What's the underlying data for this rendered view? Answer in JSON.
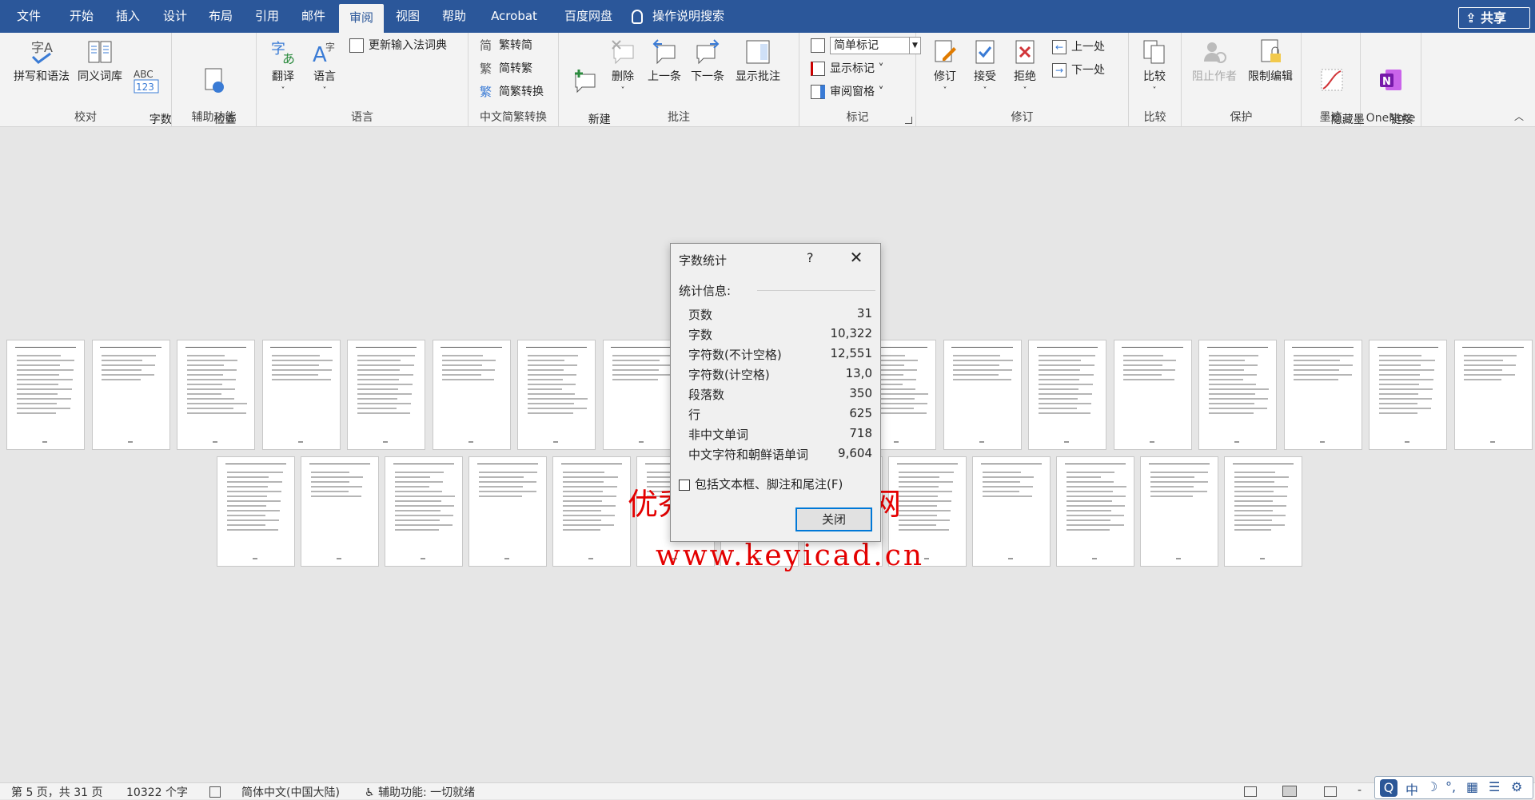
{
  "menubar": {
    "tabs": [
      {
        "label": "文件"
      },
      {
        "label": "开始"
      },
      {
        "label": "插入"
      },
      {
        "label": "设计"
      },
      {
        "label": "布局"
      },
      {
        "label": "引用"
      },
      {
        "label": "邮件"
      },
      {
        "label": "审阅"
      },
      {
        "label": "视图"
      },
      {
        "label": "帮助"
      },
      {
        "label": "Acrobat"
      },
      {
        "label": "百度网盘"
      }
    ],
    "active_tab": "审阅",
    "tell_me": "操作说明搜索",
    "share": "共享",
    "bg_color": "#2b579a"
  },
  "ribbon": {
    "proofing": {
      "label": "校对",
      "spell": "拼写和语法",
      "thesaurus": "同义词库",
      "wordcount": "字数\n统计"
    },
    "accessibility": {
      "label": "辅助功能",
      "check": "检查\n辅助功能 ˅"
    },
    "language": {
      "label": "语言",
      "translate": "翻译",
      "language": "语言",
      "update_ime": "更新输入法词典"
    },
    "chinese": {
      "label": "中文简繁转换",
      "to_simp": "繁转简",
      "to_trad": "简转繁",
      "convert": "简繁转换"
    },
    "comments": {
      "label": "批注",
      "new": "新建\n批注",
      "delete": "删除",
      "prev": "上一条",
      "next": "下一条",
      "show": "显示批注"
    },
    "tracking": {
      "label": "标记",
      "markup_combo": "简单标记",
      "show_markup": "显示标记 ˅",
      "review_pane": "审阅窗格 ˅"
    },
    "changes": {
      "label": "修订",
      "track": "修订",
      "accept": "接受",
      "reject": "拒绝",
      "prev": "上一处",
      "next": "下一处"
    },
    "compare": {
      "label": "比较",
      "compare": "比较"
    },
    "protect": {
      "label": "保护",
      "block_authors": "阻止作者",
      "restrict": "限制编辑"
    },
    "ink": {
      "label": "墨迹",
      "hide_ink": "隐藏墨\n迹 ˅"
    },
    "onenote": {
      "label": "OneNote",
      "linked": "链接\n笔记"
    }
  },
  "dialog": {
    "title": "字数统计",
    "help": "?",
    "close_icon": "✕",
    "stats_heading": "统计信息:",
    "rows": [
      {
        "label": "页数",
        "value": "31"
      },
      {
        "label": "字数",
        "value": "10,322"
      },
      {
        "label": "字符数(不计空格)",
        "value": "12,551"
      },
      {
        "label": "字符数(计空格)",
        "value": "13,0"
      },
      {
        "label": "段落数",
        "value": "350"
      },
      {
        "label": "行",
        "value": "625"
      },
      {
        "label": "非中文单词",
        "value": "718"
      },
      {
        "label": "中文字符和朝鲜语单词",
        "value": "9,604"
      }
    ],
    "include_label": "包括文本框、脚注和尾注(F)",
    "close_button": "关闭"
  },
  "watermark": {
    "line1": "优秀毕业设计资源网",
    "line2": "www.keyicad.cn",
    "color": "#e40000"
  },
  "statusbar": {
    "page": "第 5 页，共 31 页",
    "words": "10322 个字",
    "lang": "简体中文(中国大陆)",
    "accessibility": "辅助功能: 一切就绪",
    "zoom_minus": "-"
  },
  "ime": {
    "label": "中"
  }
}
